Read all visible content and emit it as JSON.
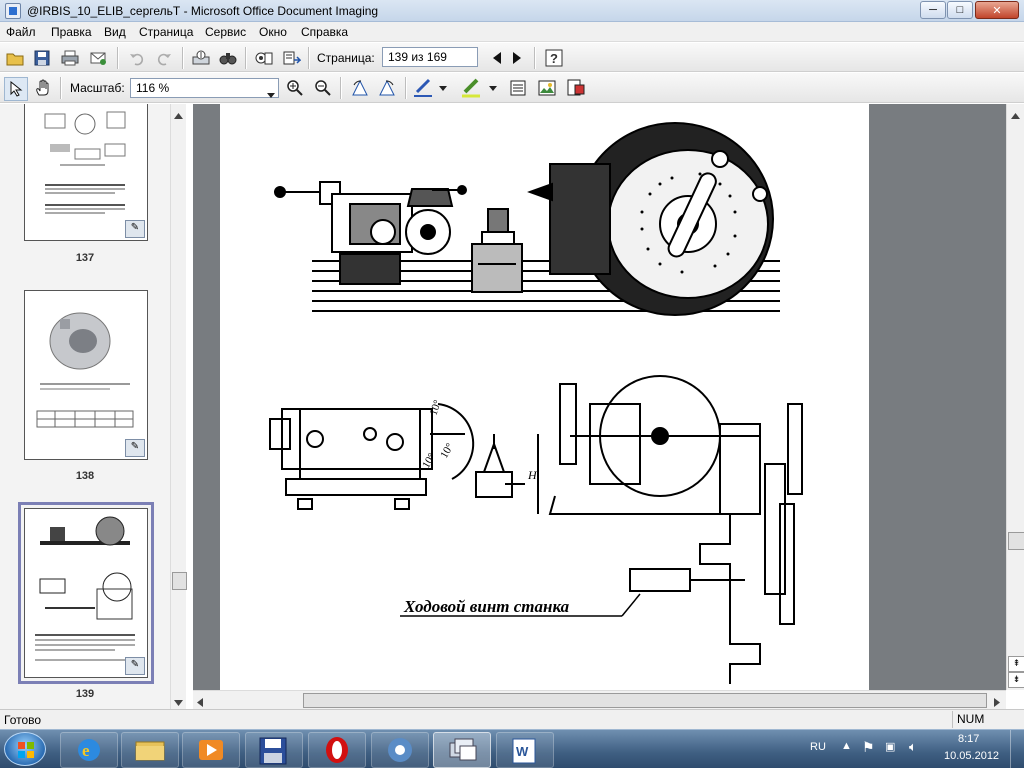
{
  "window": {
    "title": "@IRBIS_10_ELIB_сергельТ - Microsoft Office Document Imaging",
    "controls": {
      "minimize": "─",
      "maximize": "□",
      "close": "✕"
    }
  },
  "menu": [
    "Файл",
    "Правка",
    "Вид",
    "Страница",
    "Сервис",
    "Окно",
    "Справка"
  ],
  "toolbar1": {
    "page_label": "Страница:",
    "page_value": "139 из 169",
    "buttons": [
      "open-icon",
      "save-icon",
      "print-icon",
      "send-icon",
      "undo-icon",
      "redo-icon",
      "scan-icon",
      "find-icon",
      "ocr-icon",
      "send-text-icon",
      "prev-page-icon",
      "next-page-icon",
      "help-icon"
    ]
  },
  "toolbar2": {
    "zoom_label": "Масштаб:",
    "zoom_value": "116 %",
    "buttons": [
      "select-icon",
      "hand-icon",
      "zoom-in-icon",
      "zoom-out-icon",
      "rotate-left-icon",
      "rotate-right-icon",
      "pen-icon",
      "highlighter-icon",
      "text-box-icon",
      "picture-icon",
      "annotations-icon"
    ]
  },
  "thumbnails": [
    {
      "page": "137"
    },
    {
      "page": "138"
    },
    {
      "page": "139",
      "selected": true
    }
  ],
  "document": {
    "caption": "Ходовой винт станка",
    "dim_h": "H",
    "angle_1": "10°",
    "angle_2": "10°",
    "angle_3": "10°"
  },
  "status": {
    "text": "Готово",
    "num": "NUM"
  },
  "taskbar": {
    "apps": [
      "ie-icon",
      "explorer-icon",
      "media-player-icon",
      "save-disk-icon",
      "opera-icon",
      "msodi-icon",
      "windows-icon",
      "word-icon"
    ],
    "active_app": "windows-icon",
    "lang": "RU",
    "time": "8:17",
    "date": "10.05.2012"
  },
  "colors": {
    "accent": "#7b7fb5",
    "doc_background": "#787c80",
    "taskbar": "#3f5f82"
  }
}
